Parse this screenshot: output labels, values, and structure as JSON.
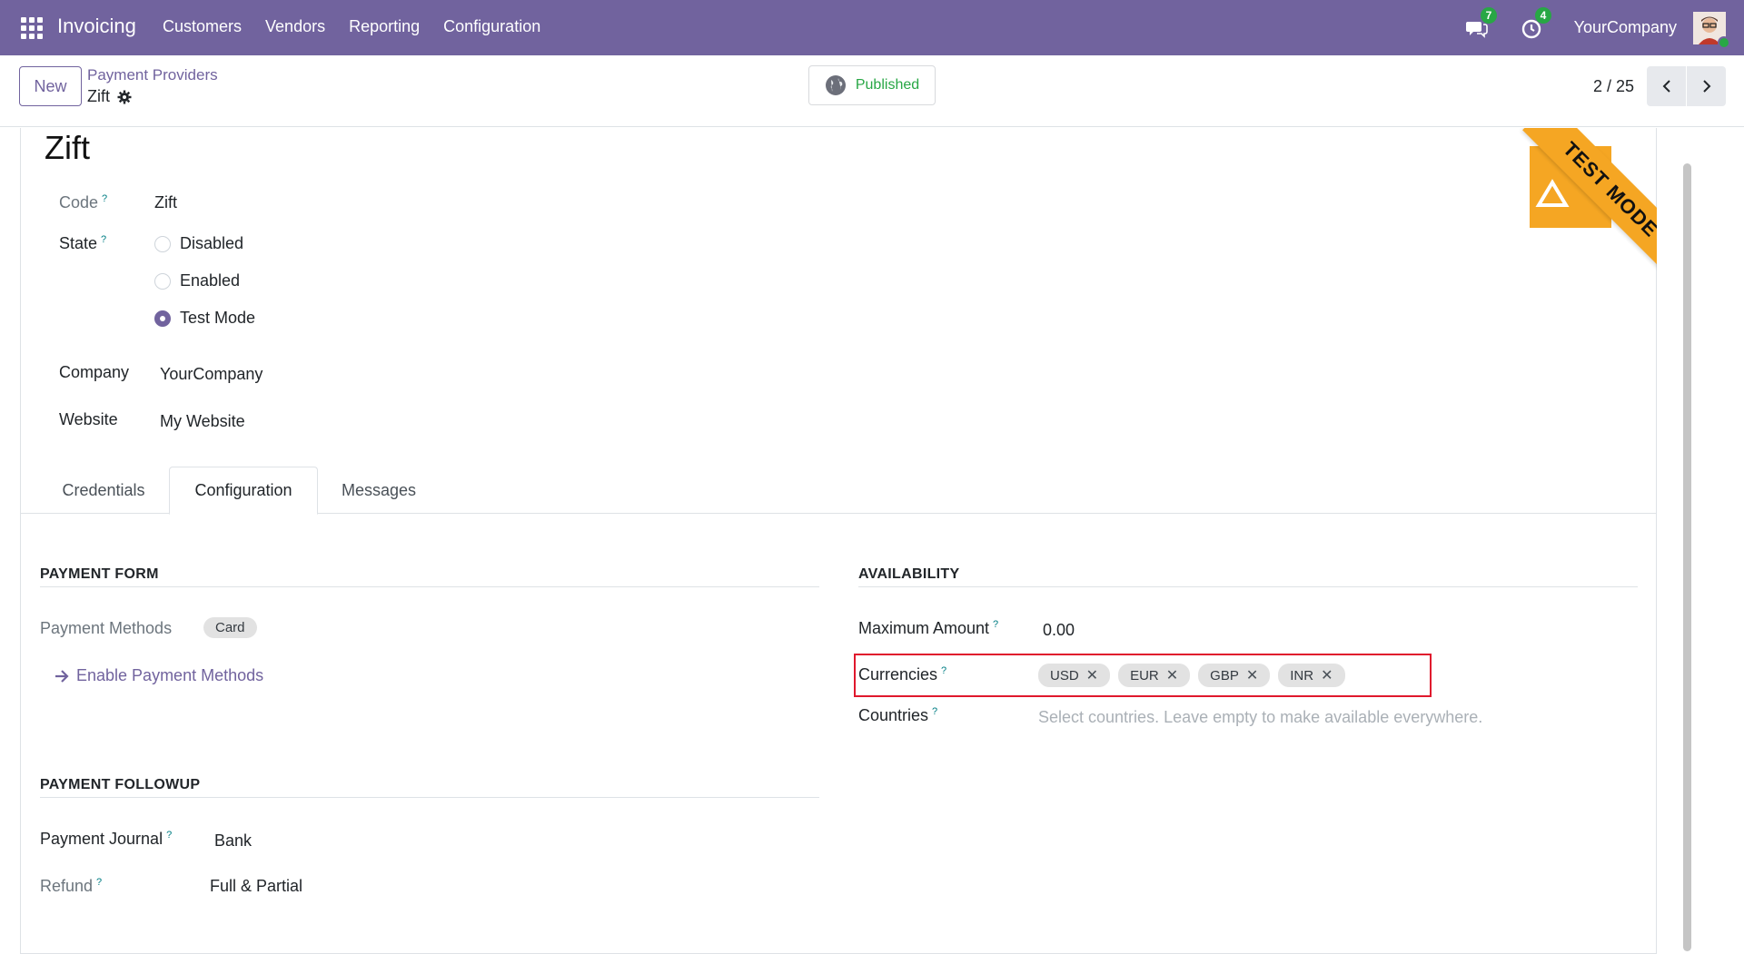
{
  "navbar": {
    "app_name": "Invoicing",
    "menu": [
      "Customers",
      "Vendors",
      "Reporting",
      "Configuration"
    ],
    "messages_count": "7",
    "activities_count": "4",
    "company": "YourCompany"
  },
  "control_panel": {
    "new_label": "New",
    "breadcrumb_parent": "Payment Providers",
    "breadcrumb_current": "Zift",
    "published_label": "Published",
    "pager_value": "2 / 25"
  },
  "record": {
    "title": "Zift",
    "code_label": "Code",
    "code_value": "Zift",
    "state_label": "State",
    "state_options": [
      "Disabled",
      "Enabled",
      "Test Mode"
    ],
    "state_selected": "Test Mode",
    "company_label": "Company",
    "company_value": "YourCompany",
    "website_label": "Website",
    "website_value": "My Website",
    "ribbon_text": "TEST MODE"
  },
  "tabs": [
    "Credentials",
    "Configuration",
    "Messages"
  ],
  "active_tab": "Configuration",
  "payment_form": {
    "title": "PAYMENT FORM",
    "methods_label": "Payment Methods",
    "methods_tag": "Card",
    "enable_link": "Enable Payment Methods"
  },
  "payment_followup": {
    "title": "PAYMENT FOLLOWUP",
    "journal_label": "Payment Journal",
    "journal_value": "Bank",
    "refund_label": "Refund",
    "refund_value": "Full & Partial"
  },
  "availability": {
    "title": "AVAILABILITY",
    "max_amount_label": "Maximum Amount",
    "max_amount_value": "0.00",
    "currencies_label": "Currencies",
    "currencies": [
      "USD",
      "EUR",
      "GBP",
      "INR"
    ],
    "countries_label": "Countries",
    "countries_placeholder": "Select countries. Leave empty to make available everywhere."
  },
  "colors": {
    "navbar": "#71639e",
    "published": "#28a745",
    "ribbon": "#f5a623",
    "highlight": "#e0182d"
  }
}
